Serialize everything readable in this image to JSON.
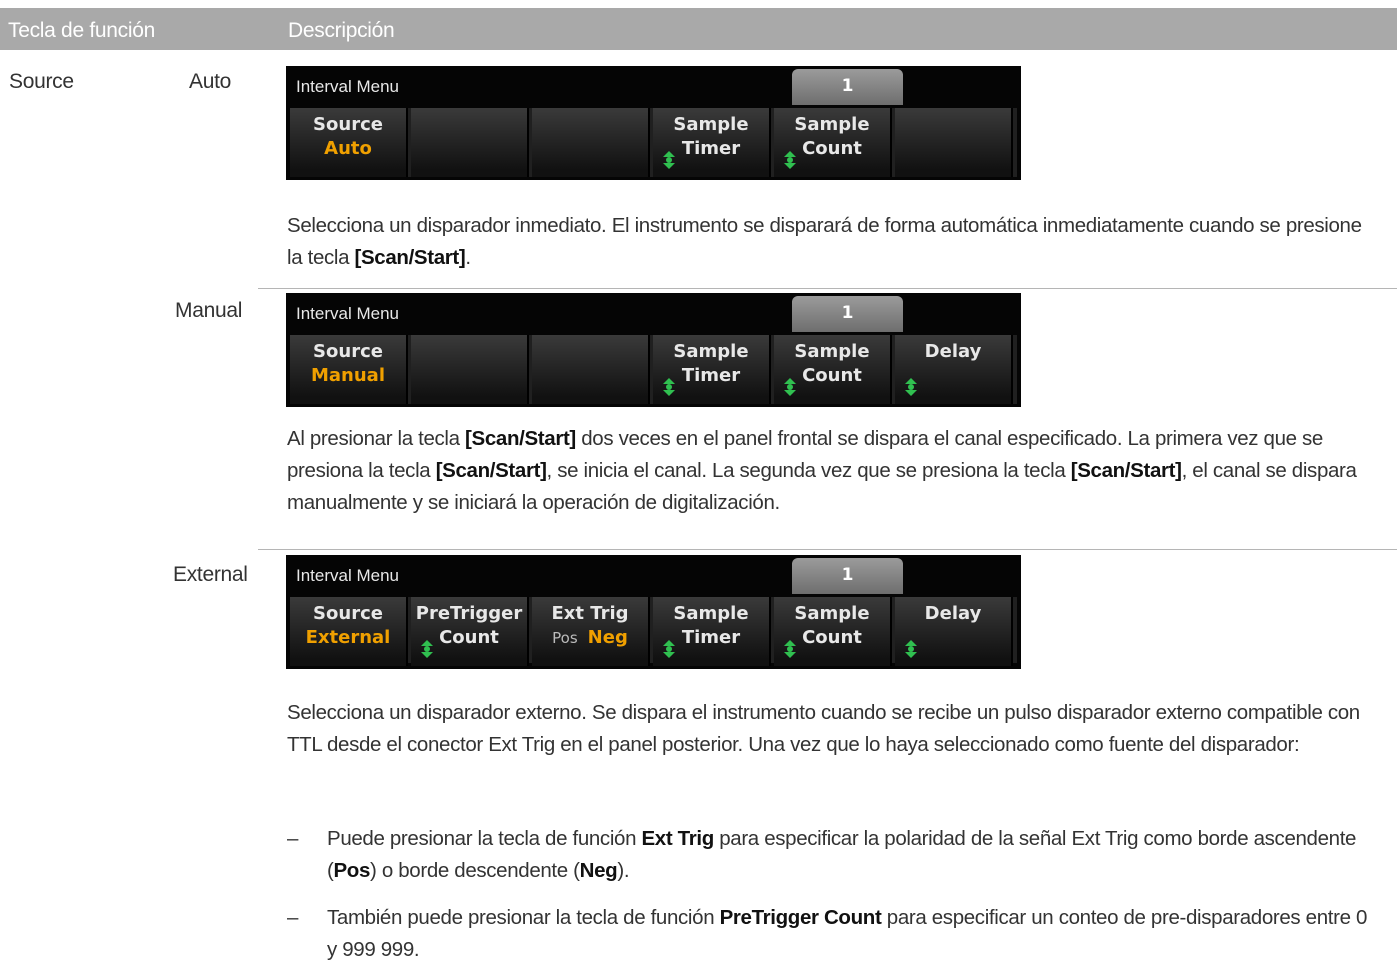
{
  "header": {
    "col1": "Tecla de función",
    "col2": "Descripción"
  },
  "rows": [
    {
      "key": "Source",
      "option": "Auto",
      "display": {
        "title": "Interval Menu",
        "indicator": "1",
        "softkeys": [
          {
            "line1": "Source",
            "line2": "Auto"
          },
          {
            "line1": "",
            "line2": ""
          },
          {
            "line1": "",
            "line2": ""
          },
          {
            "line1": "Sample",
            "line2": "Timer"
          },
          {
            "line1": "Sample",
            "line2": "Count"
          },
          {
            "line1": "",
            "line2": ""
          }
        ]
      },
      "description": {
        "part1": "Selecciona un disparador inmediato. El instrumento se disparará de forma automática inmediatamente cuando se presione la tecla ",
        "bold1": "[Scan/Start]",
        "part2": "."
      }
    },
    {
      "option": "Manual",
      "display": {
        "title": "Interval Menu",
        "indicator": "1",
        "softkeys": [
          {
            "line1": "Source",
            "line2": "Manual"
          },
          {
            "line1": "",
            "line2": ""
          },
          {
            "line1": "",
            "line2": ""
          },
          {
            "line1": "Sample",
            "line2": "Timer"
          },
          {
            "line1": "Sample",
            "line2": "Count"
          },
          {
            "line1": "Delay",
            "line2": ""
          }
        ]
      },
      "description": {
        "part1": "Al presionar la tecla ",
        "bold1": "[Scan/Start]",
        "part2": " dos veces en el panel frontal se dispara el canal especificado. La primera vez que se presiona la tecla ",
        "bold2": "[Scan/Start]",
        "part3": ", se inicia el canal. La segunda vez que se presiona la tecla ",
        "bold3": "[Scan/Start]",
        "part4": ", el canal se dispara manualmente y se iniciará la operación de digitalización."
      }
    },
    {
      "option": "External",
      "display": {
        "title": "Interval Menu",
        "indicator": "1",
        "softkeys": [
          {
            "line1": "Source",
            "line2": "External"
          },
          {
            "line1": "PreTrigger",
            "line2": "Count"
          },
          {
            "line1": "Ext Trig",
            "line2_pos": "Pos",
            "line2_neg": "Neg"
          },
          {
            "line1": "Sample",
            "line2": "Timer"
          },
          {
            "line1": "Sample",
            "line2": "Count"
          },
          {
            "line1": "Delay",
            "line2": ""
          }
        ]
      },
      "description": {
        "text": "Selecciona un disparador externo. Se dispara el instrumento cuando se recibe un pulso disparador externo compatible con TTL desde el conector Ext Trig en el panel posterior. Una vez que lo haya seleccionado como fuente del disparador:"
      },
      "bullets": [
        {
          "dash": "–",
          "a": "Puede presionar la tecla de función ",
          "b1": "Ext Trig",
          "c": " para especificar la polaridad de la señal Ext Trig como borde ascendente (",
          "b2": "Pos",
          "d": ") o borde descendente (",
          "b3": "Neg",
          "e": ")."
        },
        {
          "dash": "–",
          "a": "También puede presionar la tecla de función ",
          "b1": "PreTrigger Count",
          "c": " para especificar un conteo de pre-disparadores entre 0 y 999 999."
        }
      ]
    }
  ],
  "colors": {
    "header_bg": "#a9a9a9",
    "display_bg": "#050505",
    "accent_orange": "#f0a000",
    "indicator_gray": "#8a8a8a"
  },
  "icons": {
    "knob": "rotary-knob-icon"
  }
}
